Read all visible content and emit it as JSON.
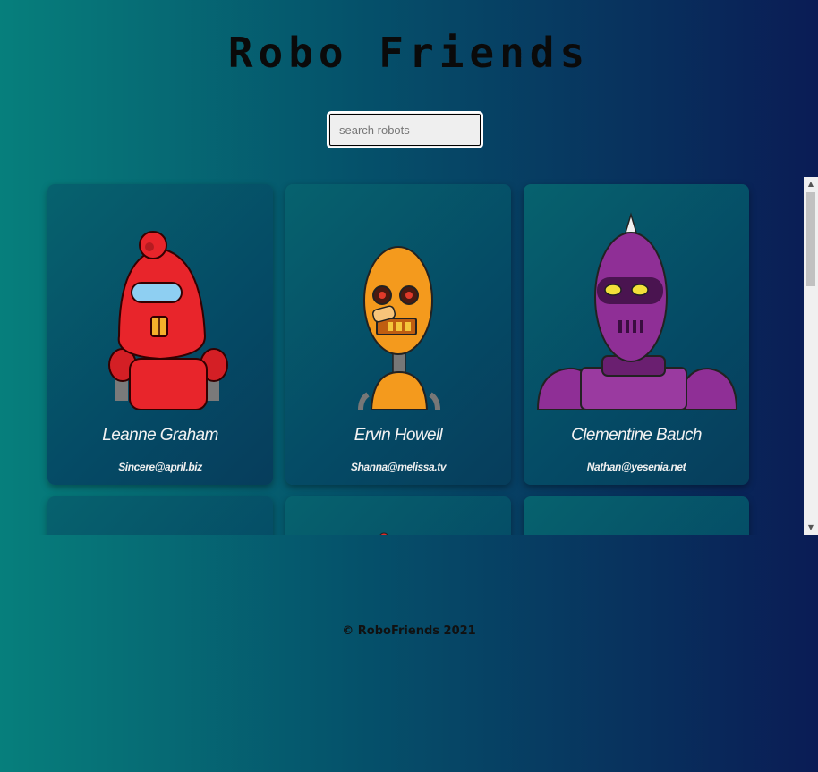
{
  "header": {
    "title": "Robo Friends"
  },
  "search": {
    "placeholder": "search robots"
  },
  "cards": [
    {
      "name": "Leanne Graham",
      "email": "Sincere@april.biz",
      "color": "#e8252b"
    },
    {
      "name": "Ervin Howell",
      "email": "Shanna@melissa.tv",
      "color": "#f49a1d"
    },
    {
      "name": "Clementine Bauch",
      "email": "Nathan@yesenia.net",
      "color": "#8f2f96"
    },
    {
      "name": "",
      "email": "",
      "color": "#9a9a9a"
    },
    {
      "name": "",
      "email": "",
      "color": "#e02a2a"
    },
    {
      "name": "",
      "email": "",
      "color": ""
    }
  ],
  "footer": {
    "text": "© RoboFriends 2021"
  },
  "scrollbar": {
    "up_icon": "triangle-up-icon",
    "down_icon": "triangle-down-icon"
  }
}
